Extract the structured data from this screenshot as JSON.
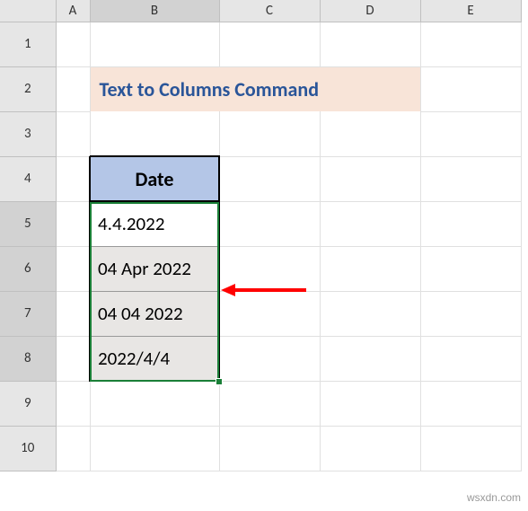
{
  "columns": [
    "A",
    "B",
    "C",
    "D",
    "E"
  ],
  "rows": [
    "1",
    "2",
    "3",
    "4",
    "5",
    "6",
    "7",
    "8",
    "9",
    "10"
  ],
  "title": "Text to Columns Command",
  "table_header": "Date",
  "data_values": [
    "4.4.2022",
    "04 Apr 2022",
    "04 04 2022",
    "2022/4/4"
  ],
  "watermark": "wsxdn.com",
  "active_col": "B",
  "active_rows": [
    "5",
    "6",
    "7",
    "8"
  ]
}
